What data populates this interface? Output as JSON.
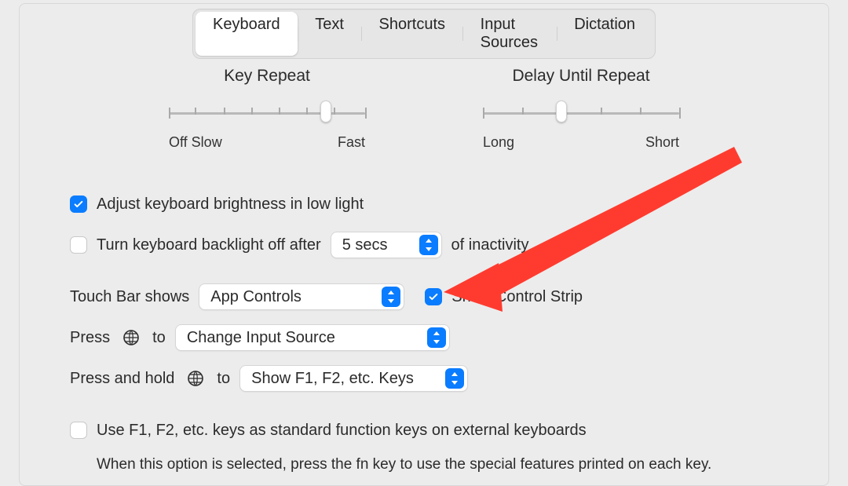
{
  "tabs": {
    "keyboard": "Keyboard",
    "text": "Text",
    "shortcuts": "Shortcuts",
    "input_sources": "Input Sources",
    "dictation": "Dictation",
    "selected": "keyboard"
  },
  "key_repeat": {
    "title": "Key Repeat",
    "left_labels": "Off  Slow",
    "right_label": "Fast",
    "value_pct": 80
  },
  "delay_repeat": {
    "title": "Delay Until Repeat",
    "left_label": "Long",
    "right_label": "Short",
    "value_pct": 40
  },
  "adjust_brightness": {
    "label": "Adjust keyboard brightness in low light",
    "checked": true
  },
  "backlight_off": {
    "label": "Turn keyboard backlight off after",
    "checked": false,
    "value": "5 secs",
    "suffix": "of inactivity"
  },
  "touch_bar": {
    "label": "Touch Bar shows",
    "value": "App Controls",
    "show_strip_checked": true,
    "show_strip_label": "Show Control Strip"
  },
  "press_globe": {
    "prefix": "Press",
    "suffix": "to",
    "value": "Change Input Source"
  },
  "hold_globe": {
    "prefix": "Press and hold",
    "suffix": "to",
    "value": "Show F1, F2, etc. Keys"
  },
  "fn_keys": {
    "checked": false,
    "label": "Use F1, F2, etc. keys as standard function keys on external keyboards",
    "description": "When this option is selected, press the fn key to use the special features printed on each key."
  },
  "colors": {
    "accent": "#0a7cff",
    "arrow": "#ff3b2f"
  }
}
